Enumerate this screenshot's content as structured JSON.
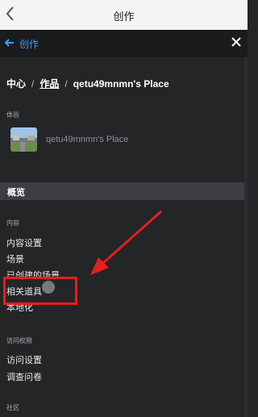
{
  "topbar": {
    "title": "创作"
  },
  "nav": {
    "back_label": "创作"
  },
  "breadcrumb": {
    "home": "中心",
    "works": "作品",
    "current": "qetu49mnmn's Place"
  },
  "experience": {
    "section_label": "体验",
    "name": "qetu49mnmn's Place"
  },
  "overview": {
    "label": "概览"
  },
  "content": {
    "section_label": "内容",
    "items": [
      "内容设置",
      "场景",
      "已创建的场景",
      "相关道具",
      "本地化"
    ]
  },
  "access": {
    "section_label": "访问权限",
    "items": [
      "访问设置",
      "调查问卷"
    ]
  },
  "community": {
    "section_label": "社区"
  },
  "colors": {
    "accent": "#3aa0ff",
    "highlight": "#e51e1e",
    "background": "#232527"
  }
}
